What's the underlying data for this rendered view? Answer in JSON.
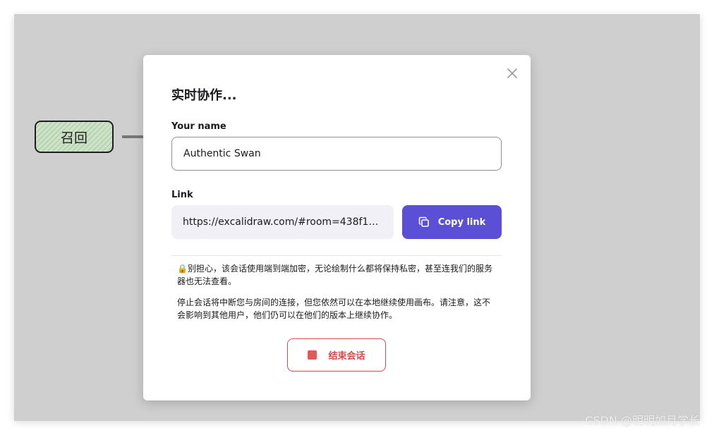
{
  "canvas": {
    "node_label": "召回"
  },
  "dialog": {
    "title": "实时协作...",
    "name_label": "Your name",
    "name_value": "Authentic Swan",
    "link_label": "Link",
    "link_value": "https://excalidraw.com/#room=438f18c…",
    "copy_label": "Copy link",
    "note_privacy": "🔒别担心，该会话使用端到端加密，无论绘制什么都将保持私密，甚至连我们的服务器也无法查看。",
    "note_stop": "停止会话将中断您与房间的连接，但您依然可以在本地继续使用画布。请注意，这不会影响到其他用户，他们仍可以在他们的版本上继续协作。",
    "stop_label": "结束会话"
  },
  "watermark": "CSDN @明明如月学长",
  "colors": {
    "primary": "#5b4fd6",
    "danger": "#d14b4b",
    "backdrop": "#cfcfcf",
    "node_fill": "#cfe3c9"
  },
  "icons": {
    "close": "close-icon",
    "copy": "copy-icon",
    "stop": "stop-icon",
    "lock": "lock-icon"
  }
}
